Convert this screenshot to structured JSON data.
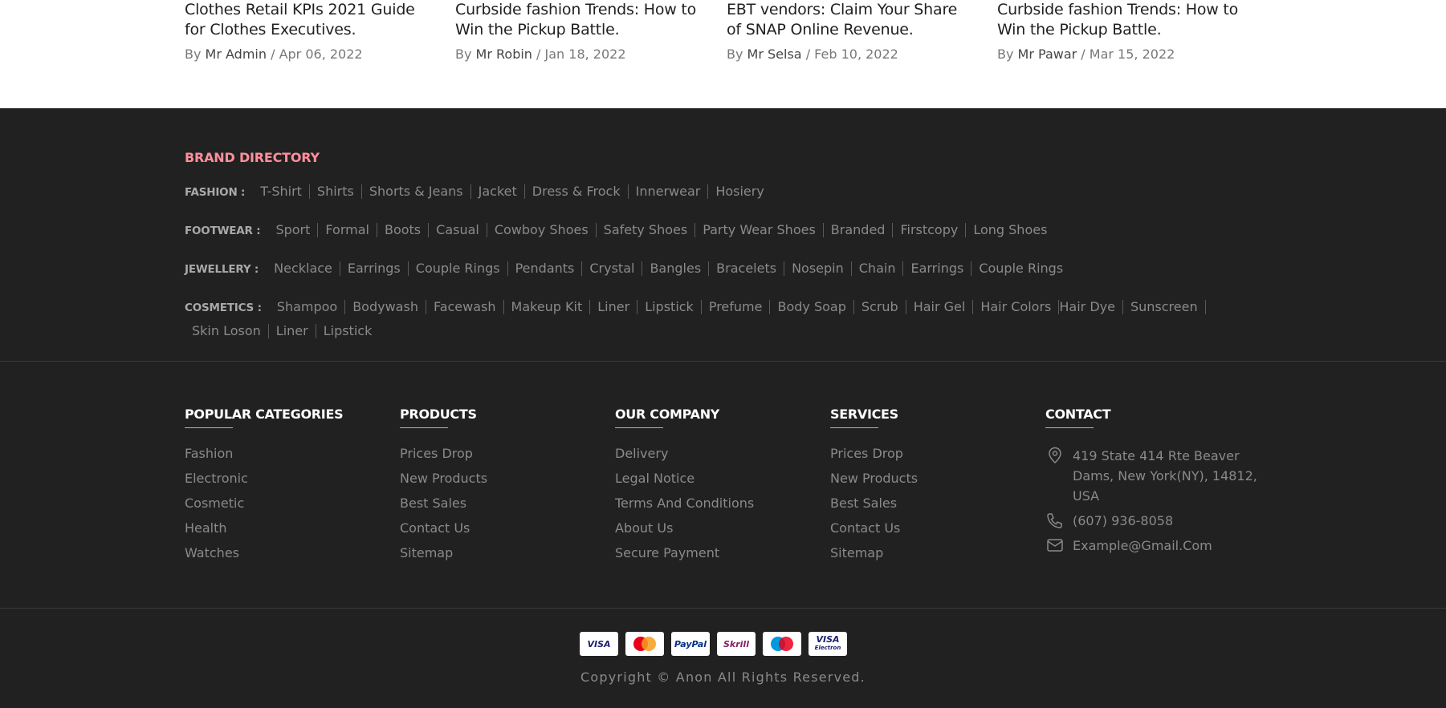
{
  "blog": [
    {
      "title": "Clothes Retail KPIs 2021 Guide for Clothes Executives.",
      "by": "By",
      "author": "Mr Admin",
      "sep": " / ",
      "date": "Apr 06, 2022"
    },
    {
      "title": "Curbside fashion Trends: How to Win the Pickup Battle.",
      "by": "By",
      "author": "Mr Robin",
      "sep": " / ",
      "date": "Jan 18, 2022"
    },
    {
      "title": "EBT vendors: Claim Your Share of SNAP Online Revenue.",
      "by": "By",
      "author": "Mr Selsa",
      "sep": " / ",
      "date": "Feb 10, 2022"
    },
    {
      "title": "Curbside fashion Trends: How to Win the Pickup Battle.",
      "by": "By",
      "author": "Mr Pawar",
      "sep": " / ",
      "date": "Mar 15, 2022"
    }
  ],
  "brand_directory": {
    "title": "Brand Directory",
    "rows": [
      {
        "label": "Fashion :",
        "links": [
          "T-Shirt",
          "Shirts",
          "Shorts & Jeans",
          "Jacket",
          "Dress & Frock",
          "Innerwear",
          "Hosiery"
        ]
      },
      {
        "label": "Footwear :",
        "links": [
          "Sport",
          "Formal",
          "Boots",
          "Casual",
          "Cowboy Shoes",
          "Safety Shoes",
          "Party Wear Shoes",
          "Branded",
          "Firstcopy",
          "Long Shoes"
        ]
      },
      {
        "label": "Jewellery :",
        "links": [
          "Necklace",
          "Earrings",
          "Couple Rings",
          "Pendants",
          "Crystal",
          "Bangles",
          "Bracelets",
          "Nosepin",
          "Chain",
          "Earrings",
          "Couple Rings"
        ]
      },
      {
        "label": "Cosmetics :",
        "links": [
          "Shampoo",
          "Bodywash",
          "Facewash",
          "Makeup Kit",
          "Liner",
          "Lipstick",
          "Prefume",
          "Body Soap",
          "Scrub",
          "Hair Gel",
          "Hair Colors",
          "Hair Dye",
          "Sunscreen",
          "Skin Loson",
          "Liner",
          "Lipstick"
        ]
      }
    ]
  },
  "columns": [
    {
      "title": "Popular Categories",
      "items": [
        "Fashion",
        "Electronic",
        "Cosmetic",
        "Health",
        "Watches"
      ]
    },
    {
      "title": "Products",
      "items": [
        "Prices Drop",
        "New Products",
        "Best Sales",
        "Contact Us",
        "Sitemap"
      ]
    },
    {
      "title": "Our Company",
      "items": [
        "Delivery",
        "Legal Notice",
        "Terms And Conditions",
        "About Us",
        "Secure Payment"
      ]
    },
    {
      "title": "Services",
      "items": [
        "Prices Drop",
        "New Products",
        "Best Sales",
        "Contact Us",
        "Sitemap"
      ]
    }
  ],
  "contact": {
    "title": "Contact",
    "address": "419 State 414 Rte Beaver Dams, New York(NY), 14812, USA",
    "phone": "(607) 936-8058",
    "email": "Example@Gmail.Com",
    "icons": [
      "location-icon",
      "phone-icon",
      "mail-icon"
    ]
  },
  "payments": [
    {
      "name": "visa-icon",
      "label": "VISA",
      "color": "#1a1f71"
    },
    {
      "name": "mastercard-icon",
      "label": "",
      "color": "#eb001b"
    },
    {
      "name": "paypal-icon",
      "label": "PayPal",
      "color": "#003087"
    },
    {
      "name": "skrill-icon",
      "label": "Skrill",
      "color": "#862165"
    },
    {
      "name": "maestro-icon",
      "label": "",
      "color": "#0099df"
    },
    {
      "name": "visa-electron-icon",
      "label": "VISA",
      "sublabel": "Electron",
      "color": "#1a1f71"
    }
  ],
  "copyright": "Copyright © Anon All Rights Reserved.",
  "colors": {
    "accent": "#ff8f9c",
    "footer_bg": "#212121"
  }
}
